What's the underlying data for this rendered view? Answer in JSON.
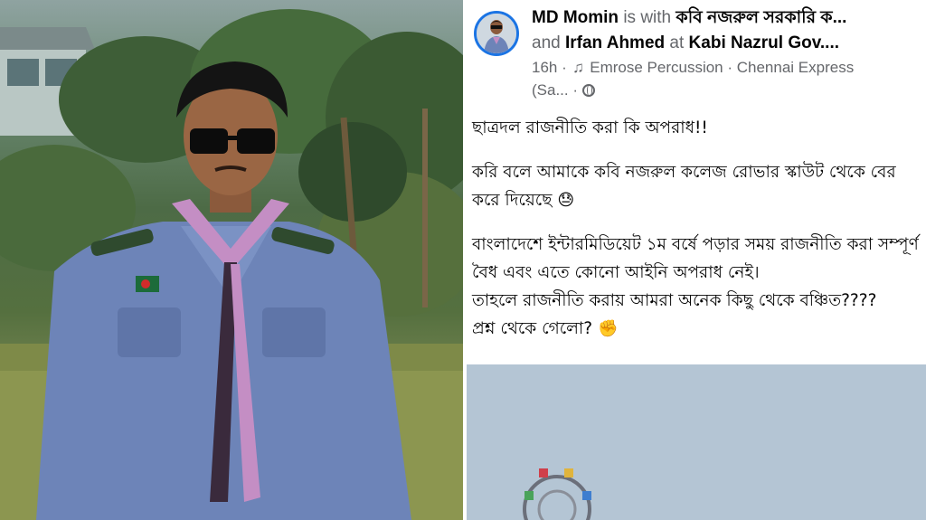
{
  "post": {
    "author": "MD Momin",
    "with_word": "is with",
    "tag1": "কবি নজরুল সরকারি ক...",
    "and_word": "and",
    "tag2": "Irfan Ahmed",
    "at_word": "at",
    "place": "Kabi Nazrul Gov....",
    "time": "16h",
    "sep_dot": "·",
    "music": "Emrose Percussion · Chennai Express",
    "music_cont": "(Sa...",
    "paragraphs": {
      "p1": "ছাত্রদল রাজনীতি করা কি অপরাধ!!",
      "p2": "করি বলে আমাকে কবি নজরুল কলেজ রোভার স্কাউট থেকে বের করে দিয়েছে",
      "p2_emoji": "😓",
      "p3_line1": "বাংলাদেশে ইন্টারমিডিয়েট ১ম বর্ষে পড়ার সময় রাজনীতি করা সম্পূর্ণ বৈধ এবং এতে কোনো আইনি অপরাধ নেই।",
      "p3_line2": "তাহলে রাজনীতি করায় আমরা অনেক কিছু থেকে বঞ্চিত????",
      "p3_line3": "প্রশ্ন থেকে গেলো?",
      "p3_emoji": "✊"
    }
  },
  "icons": {
    "music": "♫",
    "privacy": "globe-icon"
  },
  "colors": {
    "name_text": "#050505",
    "meta_text": "#65676b",
    "avatar_ring": "#1b74e4"
  }
}
